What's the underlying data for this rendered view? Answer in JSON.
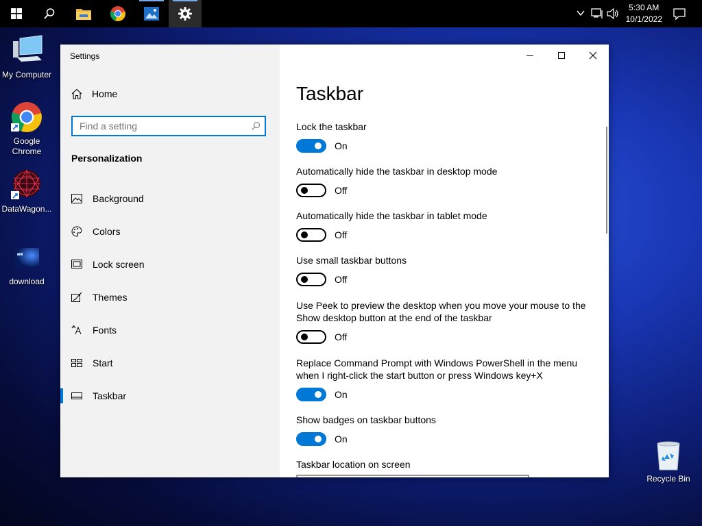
{
  "taskbar": {
    "time": "5:30 AM",
    "date": "10/1/2022"
  },
  "desktop": {
    "icons": [
      {
        "label": "My Computer"
      },
      {
        "label": "Google Chrome"
      },
      {
        "label": "DataWagon..."
      },
      {
        "label": "download"
      },
      {
        "label": "Recycle Bin"
      }
    ]
  },
  "window": {
    "title": "Settings",
    "sidebar": {
      "home_label": "Home",
      "search_placeholder": "Find a setting",
      "section_title": "Personalization",
      "items": [
        {
          "label": "Background",
          "icon": "image-icon"
        },
        {
          "label": "Colors",
          "icon": "palette-icon"
        },
        {
          "label": "Lock screen",
          "icon": "lock-screen-icon"
        },
        {
          "label": "Themes",
          "icon": "themes-icon"
        },
        {
          "label": "Fonts",
          "icon": "fonts-icon"
        },
        {
          "label": "Start",
          "icon": "start-icon"
        },
        {
          "label": "Taskbar",
          "icon": "taskbar-icon"
        }
      ],
      "selected": "Taskbar"
    },
    "page_title": "Taskbar",
    "settings": [
      {
        "label": "Lock the taskbar",
        "state": "On"
      },
      {
        "label": "Automatically hide the taskbar in desktop mode",
        "state": "Off"
      },
      {
        "label": "Automatically hide the taskbar in tablet mode",
        "state": "Off"
      },
      {
        "label": "Use small taskbar buttons",
        "state": "Off"
      },
      {
        "label": "Use Peek to preview the desktop when you move your mouse to the Show desktop button at the end of the taskbar",
        "state": "Off"
      },
      {
        "label": "Replace Command Prompt with Windows PowerShell in the menu when I right-click the start button or press Windows key+X",
        "state": "On"
      },
      {
        "label": "Show badges on taskbar buttons",
        "state": "On"
      }
    ],
    "location_label": "Taskbar location on screen"
  },
  "colors": {
    "accent": "#0078d7",
    "sidebar_bg": "#f2f2f2",
    "taskbar_bg": "#000000"
  }
}
